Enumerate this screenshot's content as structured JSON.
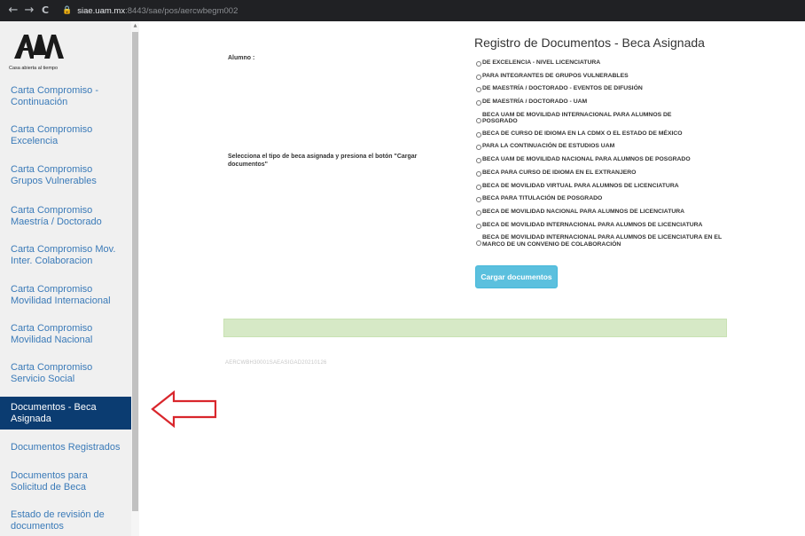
{
  "browser": {
    "back": "←",
    "forward": "→",
    "reload": "C",
    "lock": "🔒",
    "url_host": "siae.uam.mx",
    "url_path": ":8443/sae/pos/aercwbegm002"
  },
  "sidebar": {
    "logo_text": "Casa abierta al tiempo",
    "items": [
      {
        "label": "Carta Compromiso - Continuación"
      },
      {
        "label": "Carta Compromiso Excelencia"
      },
      {
        "label": "Carta Compromiso Grupos Vulnerables"
      },
      {
        "label": "Carta Compromiso Maestría / Doctorado"
      },
      {
        "label": "Carta Compromiso Mov. Inter. Colaboracion"
      },
      {
        "label": "Carta Compromiso Movilidad Internacional"
      },
      {
        "label": "Carta Compromiso Movilidad Nacional"
      },
      {
        "label": "Carta Compromiso Servicio Social"
      },
      {
        "label": "Documentos - Beca Asignada",
        "active": true
      },
      {
        "label": "Documentos Registrados"
      },
      {
        "label": "Documentos para Solicitud de Beca"
      },
      {
        "label": "Estado de revisión de documentos"
      }
    ]
  },
  "main": {
    "title": "Registro de Documentos - Beca Asignada",
    "alumno_label": "Alumno :",
    "instruction": "Selecciona el tipo de beca asignada y presiona el botón \"Cargar documentos\"",
    "options": [
      "DE EXCELENCIA - NIVEL LICENCIATURA",
      "PARA INTEGRANTES DE GRUPOS VULNERABLES",
      "DE MAESTRÍA / DOCTORADO - EVENTOS DE DIFUSIÓN",
      "DE MAESTRÍA / DOCTORADO - UAM",
      "BECA UAM DE MOVILIDAD INTERNACIONAL PARA ALUMNOS DE POSGRADO",
      "BECA DE CURSO DE IDIOMA EN LA CDMX O EL ESTADO DE MÉXICO",
      "PARA LA CONTINUACIÓN DE ESTUDIOS UAM",
      "BECA UAM DE MOVILIDAD NACIONAL PARA ALUMNOS DE POSGRADO",
      "BECA PARA CURSO DE IDIOMA EN EL EXTRANJERO",
      "BECA DE MOVILIDAD VIRTUAL PARA ALUMNOS DE LICENCIATURA",
      "BECA PARA TITULACIÓN DE POSGRADO",
      "BECA DE MOVILIDAD NACIONAL PARA ALUMNOS DE LICENCIATURA",
      "BECA DE MOVILIDAD INTERNACIONAL PARA ALUMNOS DE LICENCIATURA",
      "BECA DE MOVILIDAD INTERNACIONAL PARA ALUMNOS DE LICENCIATURA EN EL MARCO DE UN CONVENIO DE COLABORACIÓN"
    ],
    "cargar_label": "Cargar documentos",
    "code": "AERCWBH30001SAEASIGAD20210126"
  },
  "colors": {
    "sidebar_active": "#0b3c71",
    "sidebar_link": "#3a7ab8",
    "button": "#5bc0de",
    "alert": "#d6e9c6",
    "arrow": "#d9262c"
  },
  "icons": {
    "arrow": "red-outline-left-arrow"
  }
}
